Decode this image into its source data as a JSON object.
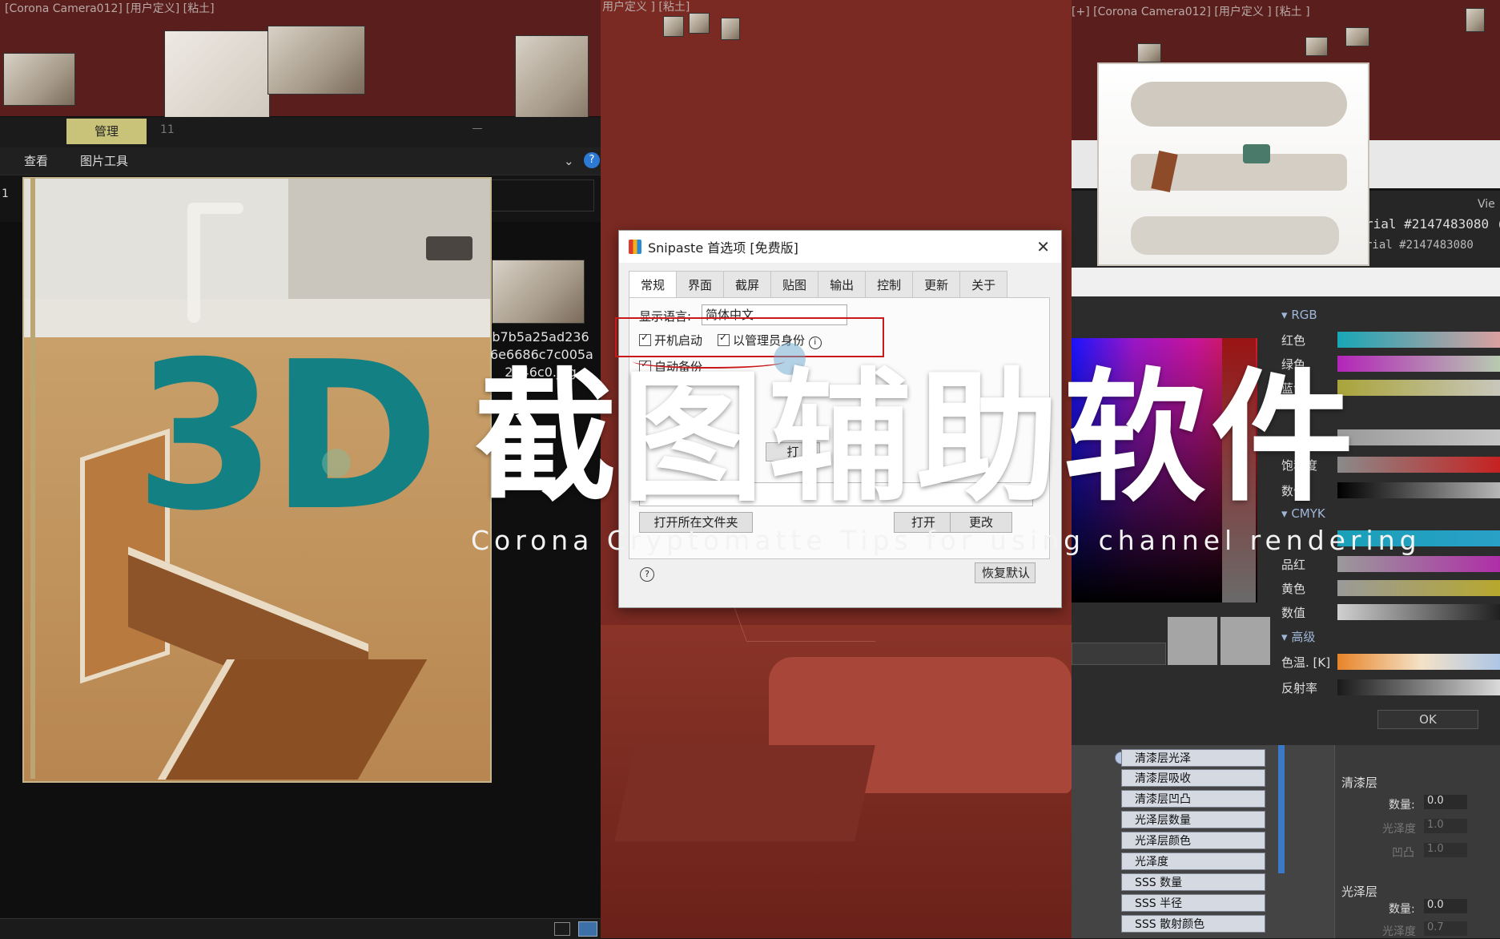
{
  "left_viewport": {
    "header": "[Corona Camera012] [用户定义] [粘土]",
    "explorer": {
      "manage_tab": "管理",
      "tab_number": "11",
      "ribbon": [
        "查看",
        "图片工具"
      ],
      "help_icon": "?",
      "page_number": "1",
      "file_name": "b7b5a25ad2366e6686c7c005a2d46c0.jpg",
      "file_name_lines": [
        "b7b5a25ad236",
        "6e6686c7c005a",
        "2d46c0.jpg"
      ]
    }
  },
  "middle_viewport": {
    "header": "用户定义 ] [粘土]"
  },
  "snipaste_dialog": {
    "title": "Snipaste 首选项 [免费版]",
    "tabs": [
      "常规",
      "界面",
      "截屏",
      "贴图",
      "输出",
      "控制",
      "更新",
      "关于"
    ],
    "active_tab": "常规",
    "language_label": "显示语言:",
    "language_value": "简体中文",
    "startup_label": "开机启动",
    "admin_label": "以管理员身份",
    "auto_backup_label": "自动备份",
    "open_folder_button": "打开所在文件夹",
    "open_button": "打开",
    "change_button": "更改",
    "open_partial": "打",
    "restore_button": "恢复默认"
  },
  "right_viewport": {
    "header": "[+] [Corona Camera012] [用户定义 ] [粘土 ]",
    "material_id_1": "rial #2147483080 ( Co",
    "material_id_2": "rial #2147483080",
    "view_tab": "Vie",
    "color_picker": {
      "rgb_header": "RGB",
      "rgb": [
        "红色",
        "绿色",
        "蓝色"
      ],
      "hsv": [
        "饱和度",
        "数值"
      ],
      "cmyk_header": "CMYK",
      "cmyk": [
        "品红",
        "黄色",
        "数值"
      ],
      "advanced_header": "高级",
      "advanced": [
        "色温. [K]",
        "反射率"
      ],
      "ok_button": "OK"
    },
    "material_slots": [
      "清漆层光泽",
      "清漆层吸收",
      "清漆层凹凸",
      "光泽层数量",
      "光泽层颜色",
      "光泽度",
      "SSS 数量",
      "SSS 半径",
      "SSS 散射颜色"
    ],
    "clearcoat_group": {
      "title": "清漆层",
      "amount_label": "数量:",
      "amount_value": "0.0",
      "gloss_label": "光泽度",
      "gloss_value": "1.0",
      "bump_label": "凹凸",
      "bump_value": "1.0"
    },
    "sheen_group": {
      "title": "光泽层",
      "amount_label": "数量:",
      "amount_value": "0.0",
      "gloss_label": "光泽度",
      "gloss_value": "0.7"
    }
  },
  "overlay": {
    "title_3d": "3D",
    "title_cn": "截图辅助软件",
    "subtitle": "Corona Cryptomatte Tips for using channel rendering"
  },
  "colors": {
    "accent_teal": "#138083",
    "viewport_red": "#7a2a22",
    "highlight_red": "#c81a1a",
    "manage_tab_yellow": "#c9c37a"
  }
}
